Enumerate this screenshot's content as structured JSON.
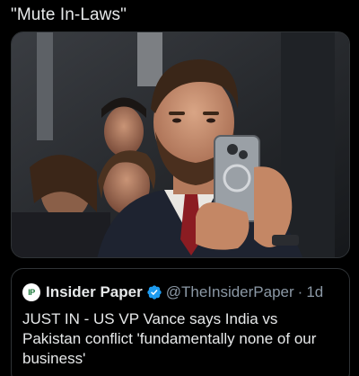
{
  "post": {
    "text": "\"Mute In-Laws\""
  },
  "media": {
    "alt": "Man with beard in suit and red tie holding up a smartphone to take a photo"
  },
  "quoted_post": {
    "logo_text": "IP",
    "author_name": "Insider Paper",
    "handle": "@TheInsiderPaper",
    "separator": "·",
    "time": "1d",
    "body": "JUST IN - US VP Vance says India vs Pakistan conflict 'fundamentally none of our business'"
  },
  "colors": {
    "background": "#000000",
    "text": "#e7e9ea",
    "secondary_text": "#8b98a5",
    "verified_badge": "#1d9bf0",
    "border": "#2f3336"
  },
  "icons": {
    "verified": "verified-badge-icon",
    "logo": "insider-paper-logo-icon"
  }
}
